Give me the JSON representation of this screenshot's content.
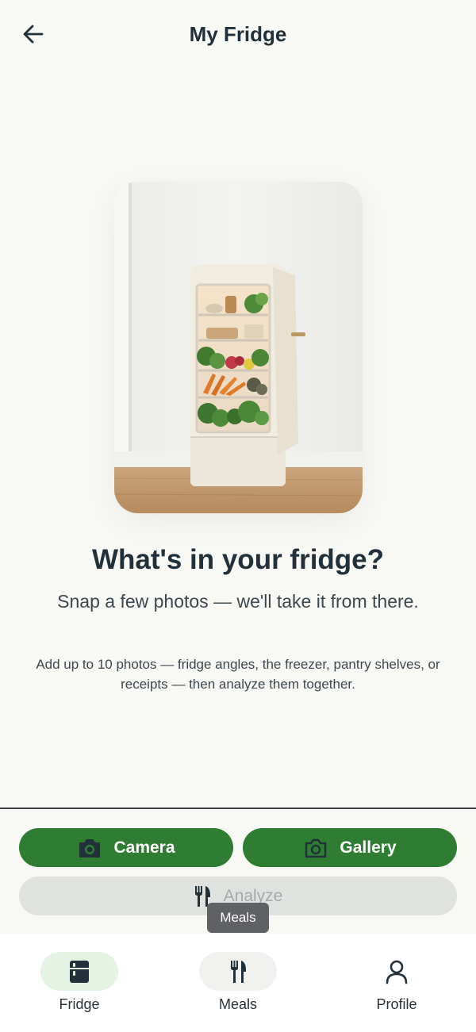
{
  "header": {
    "title": "My Fridge",
    "back_icon": "arrow-left-icon"
  },
  "main": {
    "headline": "What's in your fridge?",
    "subhead": "Snap a few photos — we'll take it from there.",
    "hint": "Add up to 10 photos — fridge angles, the freezer, pantry shelves, or receipts — then analyze them together."
  },
  "actions": {
    "camera_label": "Camera",
    "camera_icon": "camera-icon",
    "gallery_label": "Gallery",
    "gallery_icon": "camera-outline-icon",
    "analyze_label": "Analyze",
    "analyze_icon": "fork-knife-icon",
    "analyze_disabled": true
  },
  "tooltip": {
    "text": "Meals"
  },
  "bottom_nav": {
    "items": [
      {
        "label": "Fridge",
        "icon": "fridge-icon",
        "active": true
      },
      {
        "label": "Meals",
        "icon": "fork-knife-icon",
        "active": false
      },
      {
        "label": "Profile",
        "icon": "person-icon",
        "active": false
      }
    ]
  },
  "colors": {
    "background": "#f8f8f4",
    "primary": "#2e7d32",
    "text": "#22303a",
    "disabled_bg": "#e0e2df",
    "active_nav": "#e4f3e4",
    "hover_nav": "#f1f2f0"
  }
}
